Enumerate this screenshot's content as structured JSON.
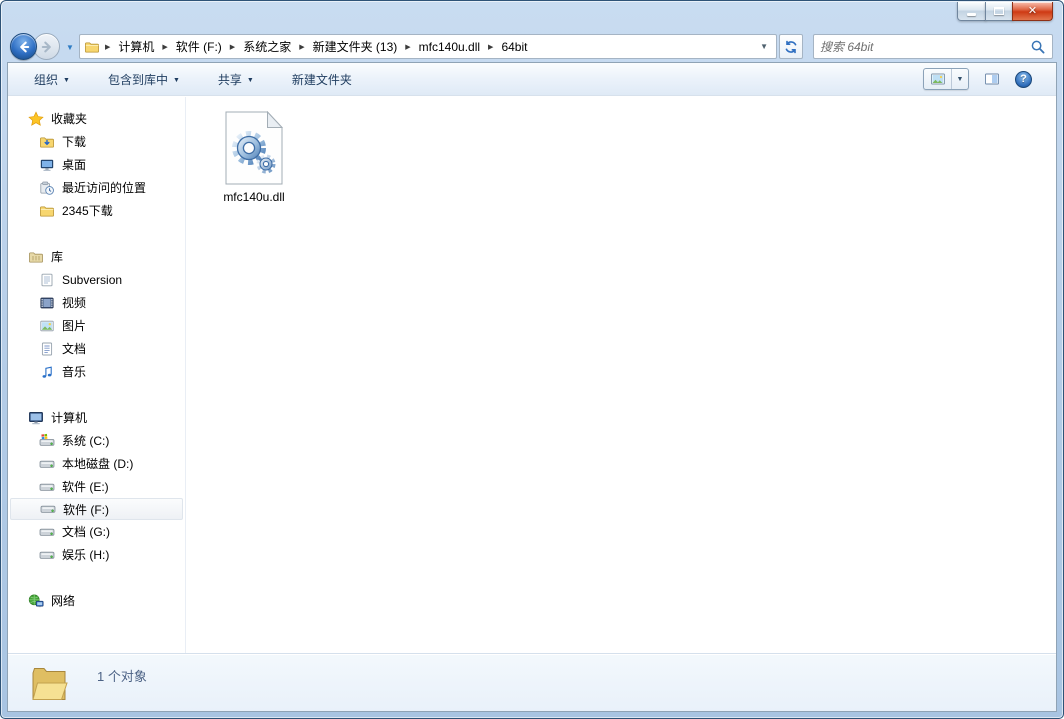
{
  "window": {
    "icons": {
      "close_glyph": "✕",
      "caret_down": "▼",
      "breadcrumb_arrow": "▶",
      "help_glyph": "?"
    }
  },
  "nav": {
    "breadcrumb": [
      "计算机",
      "软件 (F:)",
      "系统之家",
      "新建文件夹 (13)",
      "mfc140u.dll",
      "64bit"
    ],
    "search_placeholder": "搜索 64bit"
  },
  "toolbar": {
    "organize": "组织",
    "include_in_library": "包含到库中",
    "share": "共享",
    "new_folder": "新建文件夹"
  },
  "sidebar": {
    "favorites": {
      "label": "收藏夹",
      "items": [
        "下载",
        "桌面",
        "最近访问的位置",
        "2345下载"
      ]
    },
    "libraries": {
      "label": "库",
      "items": [
        "Subversion",
        "视频",
        "图片",
        "文档",
        "音乐"
      ]
    },
    "computer": {
      "label": "计算机",
      "items": [
        "系统 (C:)",
        "本地磁盘 (D:)",
        "软件 (E:)",
        "软件 (F:)",
        "文档 (G:)",
        "娱乐 (H:)"
      ]
    },
    "network": {
      "label": "网络"
    }
  },
  "content": {
    "files": [
      {
        "name": "mfc140u.dll"
      }
    ]
  },
  "status": {
    "items_count": "1 个对象"
  },
  "colors": {
    "glass_frame": "#b9d0e8",
    "toolbar_text": "#1e3c5f",
    "close_button_red": "#ce3a14",
    "details_pane": "#edf3fa",
    "selection_border": "#dfe5ec"
  }
}
